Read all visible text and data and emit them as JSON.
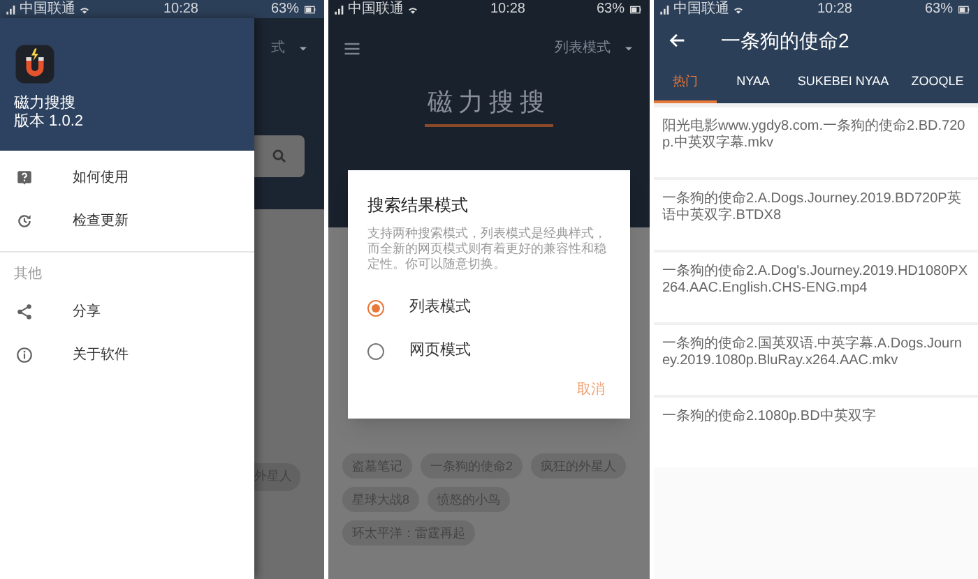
{
  "screens": [
    {
      "kind": "drawer",
      "status": {
        "carrier": "中国联通",
        "time": "10:28",
        "battery": "63%"
      },
      "drawer": {
        "app_name": "磁力搜搜",
        "version": "版本 1.0.2",
        "items": [
          {
            "label": "如何使用"
          },
          {
            "label": "检查更新"
          }
        ],
        "section": "其他",
        "other_items": [
          {
            "label": "分享"
          },
          {
            "label": "关于软件"
          }
        ]
      },
      "behind": {
        "mode": "式",
        "chips": [
          "外星人"
        ]
      }
    },
    {
      "kind": "dialog",
      "status": {
        "carrier": "中国联通",
        "time": "10:28",
        "battery": "63%"
      },
      "toolbar": {
        "mode": "列表模式"
      },
      "title": "磁力搜搜",
      "chip_rows": [
        [
          "盗墓笔记",
          "一条狗的使命2",
          "疯狂的外星人"
        ],
        [
          "星球大战8",
          "愤怒的小鸟"
        ],
        [
          "环太平洋：雷霆再起"
        ]
      ],
      "dialog": {
        "title": "搜索结果模式",
        "message": "支持两种搜索模式，列表模式是经典样式，而全新的网页模式则有着更好的兼容性和稳定性。你可以随意切换。",
        "options": [
          {
            "label": "列表模式",
            "selected": true
          },
          {
            "label": "网页模式",
            "selected": false
          }
        ],
        "button": "取消"
      }
    },
    {
      "kind": "results",
      "status": {
        "carrier": "中国联通",
        "time": "10:28",
        "battery": "63%"
      },
      "title": "一条狗的使命2",
      "tabs": [
        {
          "label": "热门",
          "selected": true
        },
        {
          "label": "NYAA",
          "selected": false
        },
        {
          "label": "SUKEBEI NYAA",
          "selected": false
        },
        {
          "label": "ZOOQLE",
          "selected": false
        }
      ],
      "results": [
        "阳光电影www.ygdy8.com.一条狗的使命2.BD.720p.中英双字幕.mkv",
        "一条狗的使命2.A.Dogs.Journey.2019.BD720P英语中英双字.BTDX8",
        "一条狗的使命2.A.Dog's.Journey.2019.HD1080PX264.AAC.English.CHS-ENG.mp4",
        "一条狗的使命2.国英双语.中英字幕.A.Dogs.Journey.2019.1080p.BluRay.x264.AAC.mkv",
        "一条狗的使命2.1080p.BD中英双字"
      ]
    }
  ]
}
